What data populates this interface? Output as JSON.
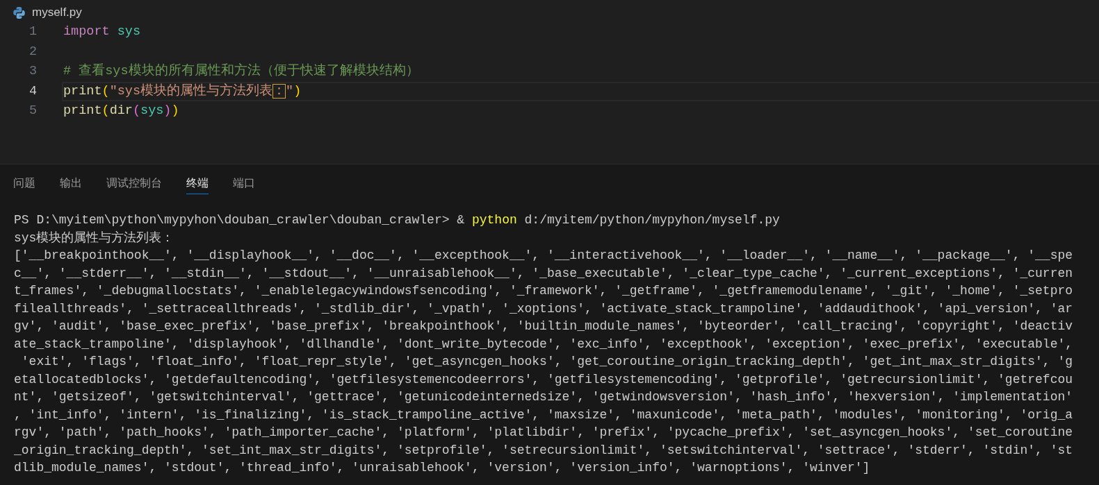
{
  "editor": {
    "file_tab": {
      "label": "myself.py"
    },
    "lines": [
      {
        "number": "1",
        "active": false,
        "tokens": [
          {
            "kind": "keyword",
            "text": "import"
          },
          {
            "kind": "module",
            "text": " sys"
          }
        ]
      },
      {
        "number": "2",
        "active": false
      },
      {
        "number": "3",
        "active": false,
        "tokens": [
          {
            "kind": "comment",
            "text": "# 查看sys模块的所有属性和方法（便于快速了解模块结构）"
          }
        ]
      },
      {
        "number": "4",
        "active": true,
        "tokens": [
          {
            "kind": "function",
            "text": "print"
          },
          {
            "kind": "bracket",
            "text": "("
          },
          {
            "kind": "string",
            "text": "\"sys模块的属性与方法列表"
          },
          {
            "kind": "flagged",
            "text": "："
          },
          {
            "kind": "string",
            "text": "\""
          },
          {
            "kind": "bracket",
            "text": ")"
          }
        ]
      },
      {
        "number": "5",
        "active": false,
        "tokens": [
          {
            "kind": "function",
            "text": "print"
          },
          {
            "kind": "bracket",
            "text": "("
          },
          {
            "kind": "function",
            "text": "dir"
          },
          {
            "kind": "bracket_inner",
            "text": "("
          },
          {
            "kind": "module",
            "text": "sys"
          },
          {
            "kind": "bracket_inner",
            "text": ")"
          },
          {
            "kind": "bracket",
            "text": ")"
          }
        ]
      }
    ]
  },
  "panel": {
    "tabs": [
      {
        "label": "问题",
        "selected": false
      },
      {
        "label": "输出",
        "selected": false
      },
      {
        "label": "调试控制台",
        "selected": false
      },
      {
        "label": "终端",
        "selected": true
      },
      {
        "label": "端口",
        "selected": false
      }
    ],
    "terminal": {
      "command": [
        {
          "kind": "plain",
          "text": "PS D:\\myitem\\python\\mypyhon\\douban_crawler\\douban_crawler> & "
        },
        {
          "kind": "command",
          "text": "python"
        },
        {
          "kind": "plain",
          "text": " d:/myitem/python/mypyhon/myself.py"
        }
      ],
      "output": [
        "sys模块的属性与方法列表：",
        "['__breakpointhook__', '__displayhook__', '__doc__', '__excepthook__', '__interactivehook__', '__loader__', '__name__', '__package__', '__spe",
        "c__', '__stderr__', '__stdin__', '__stdout__', '__unraisablehook__', '_base_executable', '_clear_type_cache', '_current_exceptions', '_curren",
        "t_frames', '_debugmallocstats', '_enablelegacywindowsfsencoding', '_framework', '_getframe', '_getframemodulename', '_git', '_home', '_setpro",
        "fileallthreads', '_settraceallthreads', '_stdlib_dir', '_vpath', '_xoptions', 'activate_stack_trampoline', 'addaudithook', 'api_version', 'ar",
        "gv', 'audit', 'base_exec_prefix', 'base_prefix', 'breakpointhook', 'builtin_module_names', 'byteorder', 'call_tracing', 'copyright', 'deactiv",
        "ate_stack_trampoline', 'displayhook', 'dllhandle', 'dont_write_bytecode', 'exc_info', 'excepthook', 'exception', 'exec_prefix', 'executable',",
        " 'exit', 'flags', 'float_info', 'float_repr_style', 'get_asyncgen_hooks', 'get_coroutine_origin_tracking_depth', 'get_int_max_str_digits', 'g",
        "etallocatedblocks', 'getdefaultencoding', 'getfilesystemencodeerrors', 'getfilesystemencoding', 'getprofile', 'getrecursionlimit', 'getrefcou",
        "nt', 'getsizeof', 'getswitchinterval', 'gettrace', 'getunicodeinternedsize', 'getwindowsversion', 'hash_info', 'hexversion', 'implementation'",
        ", 'int_info', 'intern', 'is_finalizing', 'is_stack_trampoline_active', 'maxsize', 'maxunicode', 'meta_path', 'modules', 'monitoring', 'orig_a",
        "rgv', 'path', 'path_hooks', 'path_importer_cache', 'platform', 'platlibdir', 'prefix', 'pycache_prefix', 'set_asyncgen_hooks', 'set_coroutine",
        "_origin_tracking_depth', 'set_int_max_str_digits', 'setprofile', 'setrecursionlimit', 'setswitchinterval', 'settrace', 'stderr', 'stdin', 'st",
        "dlib_module_names', 'stdout', 'thread_info', 'unraisablehook', 'version', 'version_info', 'warnoptions', 'winver']"
      ]
    }
  }
}
